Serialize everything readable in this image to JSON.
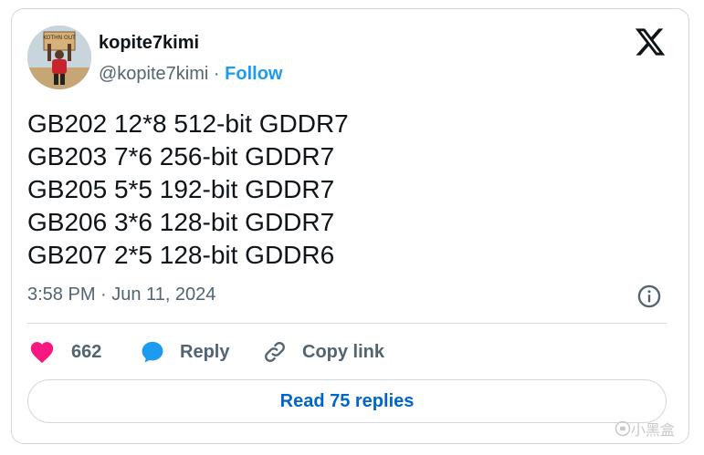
{
  "author": {
    "display_name": "kopite7kimi",
    "handle": "@kopite7kimi",
    "separator": "·",
    "follow_label": "Follow",
    "avatar_sign_text": "KOTHN OUT"
  },
  "brand_icon": "x-logo-icon",
  "tweet": {
    "lines": [
      "GB202 12*8 512-bit GDDR7",
      "GB203 7*6 256-bit GDDR7",
      "GB205 5*5 192-bit GDDR7",
      "GB206 3*6 128-bit GDDR7",
      "GB207 2*5 128-bit GDDR6"
    ],
    "timestamp": "3:58 PM · Jun 11, 2024"
  },
  "actions": {
    "like_count": "662",
    "reply_label": "Reply",
    "copy_link_label": "Copy link"
  },
  "read_replies_label": "Read 75 replies",
  "watermark_text": "小黑盒",
  "colors": {
    "like": "#f91880",
    "reply": "#1d9bf0",
    "link": "#0066cc",
    "muted": "#536471",
    "text": "#0f1419",
    "border": "#cfd9de"
  }
}
